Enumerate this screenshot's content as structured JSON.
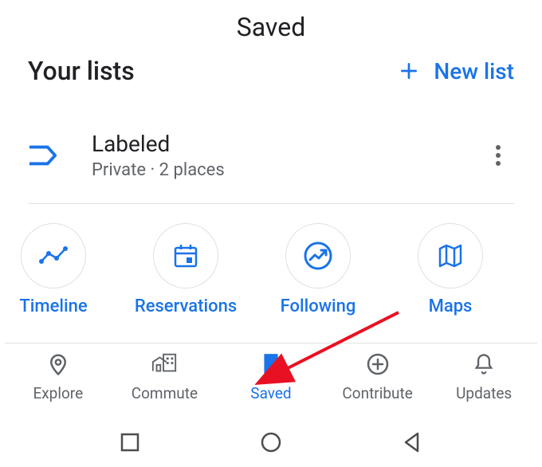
{
  "page_title": "Saved",
  "header": {
    "title": "Your lists",
    "new_list_label": "New list"
  },
  "list": {
    "name": "Labeled",
    "meta": "Private · 2 places"
  },
  "shortcuts": [
    {
      "id": "timeline",
      "label": "Timeline"
    },
    {
      "id": "reservations",
      "label": "Reservations"
    },
    {
      "id": "following",
      "label": "Following"
    },
    {
      "id": "maps",
      "label": "Maps"
    }
  ],
  "tabs": [
    {
      "id": "explore",
      "label": "Explore"
    },
    {
      "id": "commute",
      "label": "Commute"
    },
    {
      "id": "saved",
      "label": "Saved",
      "active": true
    },
    {
      "id": "contribute",
      "label": "Contribute"
    },
    {
      "id": "updates",
      "label": "Updates"
    }
  ],
  "colors": {
    "accent": "#1a73e8"
  }
}
